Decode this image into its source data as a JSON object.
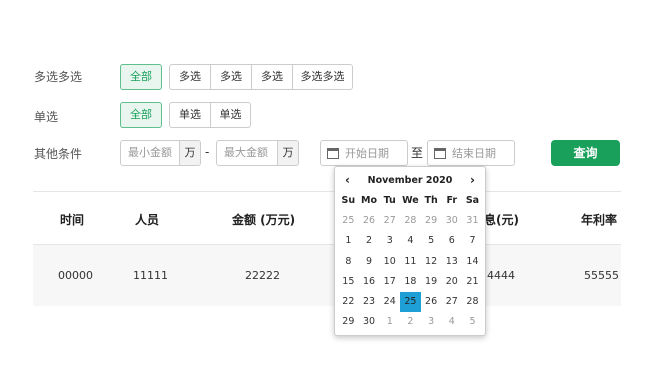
{
  "filters": {
    "multi": {
      "label": "多选多选",
      "all": "全部",
      "options": [
        "多选",
        "多选",
        "多选",
        "多选多选"
      ]
    },
    "single": {
      "label": "单选",
      "all": "全部",
      "options": [
        "单选",
        "单选"
      ]
    },
    "other": {
      "label": "其他条件",
      "min_placeholder": "最小金额",
      "max_placeholder": "最大金额",
      "unit": "万",
      "dash": "-",
      "start_placeholder": "开始日期",
      "to": "至",
      "end_placeholder": "结束日期"
    },
    "query_label": "查询"
  },
  "table": {
    "headers": [
      "时间",
      "人员",
      "金额 (万元)",
      "息(元)",
      "年利率"
    ],
    "row": [
      "00000",
      "11111",
      "22222",
      "4444",
      "55555"
    ]
  },
  "calendar": {
    "prev": "‹",
    "next": "›",
    "title": "November 2020",
    "weekdays": [
      "Su",
      "Mo",
      "Tu",
      "We",
      "Th",
      "Fr",
      "Sa"
    ],
    "weeks": [
      [
        [
          "25",
          "muted"
        ],
        [
          "26",
          "muted"
        ],
        [
          "27",
          "muted"
        ],
        [
          "28",
          "muted"
        ],
        [
          "29",
          "muted"
        ],
        [
          "30",
          "muted"
        ],
        [
          "31",
          "muted"
        ]
      ],
      [
        [
          "1",
          ""
        ],
        [
          "2",
          ""
        ],
        [
          "3",
          ""
        ],
        [
          "4",
          ""
        ],
        [
          "5",
          ""
        ],
        [
          "6",
          ""
        ],
        [
          "7",
          ""
        ]
      ],
      [
        [
          "8",
          ""
        ],
        [
          "9",
          ""
        ],
        [
          "10",
          ""
        ],
        [
          "11",
          ""
        ],
        [
          "12",
          ""
        ],
        [
          "13",
          ""
        ],
        [
          "14",
          ""
        ]
      ],
      [
        [
          "15",
          ""
        ],
        [
          "16",
          ""
        ],
        [
          "17",
          ""
        ],
        [
          "18",
          ""
        ],
        [
          "19",
          ""
        ],
        [
          "20",
          ""
        ],
        [
          "21",
          ""
        ]
      ],
      [
        [
          "22",
          ""
        ],
        [
          "23",
          ""
        ],
        [
          "24",
          ""
        ],
        [
          "25",
          "sel"
        ],
        [
          "26",
          ""
        ],
        [
          "27",
          ""
        ],
        [
          "28",
          ""
        ]
      ],
      [
        [
          "29",
          ""
        ],
        [
          "30",
          ""
        ],
        [
          "1",
          "muted"
        ],
        [
          "2",
          "muted"
        ],
        [
          "3",
          "muted"
        ],
        [
          "4",
          "muted"
        ],
        [
          "5",
          "muted"
        ]
      ]
    ],
    "selected_day": "25"
  },
  "colors": {
    "accent": "#19a05b",
    "selected_day": "#1e9fd6"
  }
}
